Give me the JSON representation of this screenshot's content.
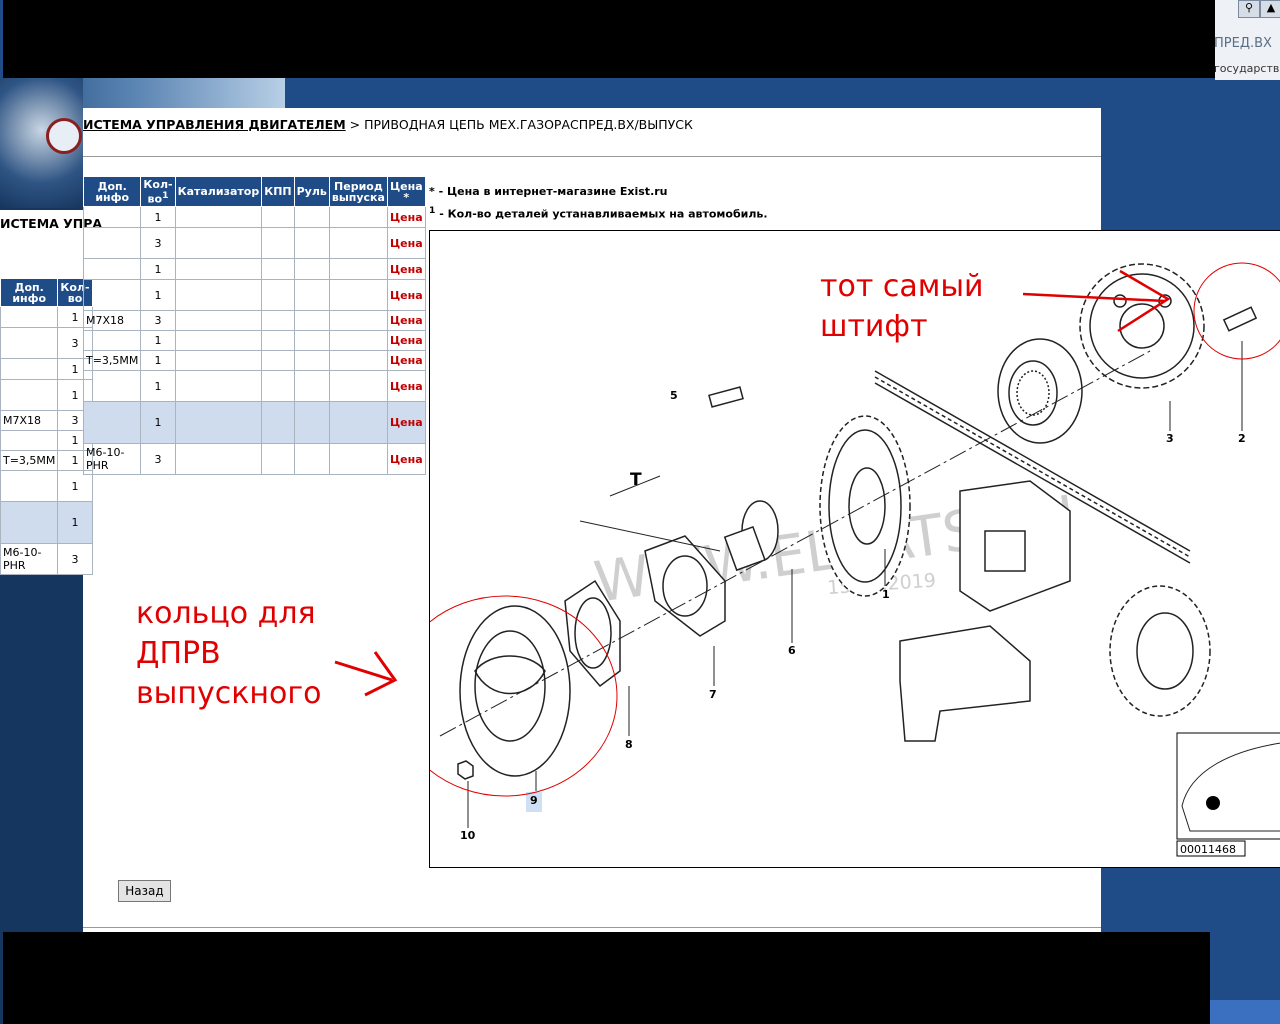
{
  "top_right": {
    "title_fragment": "ПРЕД.ВХ",
    "subtitle_fragment": "государствен"
  },
  "breadcrumb": {
    "link": "ИСТЕМА УПРАВЛЕНИЯ ДВИГАТЕЛЕМ",
    "sep": " > ",
    "current": "ПРИВОДНАЯ ЦЕПЬ МЕХ.ГАЗОРАСПРЕД.ВХ/ВЫПУСК"
  },
  "left_panel": {
    "title": "ИСТЕМА УПРА"
  },
  "table": {
    "headers": [
      "Доп. инфо",
      "Кол-во",
      "Катализатор",
      "КПП",
      "Руль",
      "Период выпуска",
      "Цена *"
    ],
    "qty_sup": "1",
    "rows": [
      {
        "info": "",
        "qty": "1",
        "price": "Цена"
      },
      {
        "info": "",
        "qty": "3",
        "price": "Цена"
      },
      {
        "info": "",
        "qty": "1",
        "price": "Цена"
      },
      {
        "info": "",
        "qty": "1",
        "price": "Цена"
      },
      {
        "info": "M7X18",
        "qty": "3",
        "price": "Цена"
      },
      {
        "info": "",
        "qty": "1",
        "price": "Цена"
      },
      {
        "info": "T=3,5MM",
        "qty": "1",
        "price": "Цена"
      },
      {
        "info": "",
        "qty": "1",
        "price": "Цена"
      },
      {
        "info": "",
        "qty": "1",
        "price": "Цена"
      },
      {
        "info": "M6-10-PHR",
        "qty": "3",
        "price": "Цена"
      }
    ]
  },
  "left_table": {
    "headers": [
      "Доп. инфо",
      "Кол-во"
    ],
    "rows": [
      {
        "info": "",
        "qty": "1"
      },
      {
        "info": "",
        "qty": "3"
      },
      {
        "info": "",
        "qty": "1"
      },
      {
        "info": "",
        "qty": "1"
      },
      {
        "info": "M7X18",
        "qty": "3"
      },
      {
        "info": "",
        "qty": "1"
      },
      {
        "info": "T=3,5MM",
        "qty": "1"
      },
      {
        "info": "",
        "qty": "1"
      },
      {
        "info": "",
        "qty": "1"
      },
      {
        "info": "M6-10-PHR",
        "qty": "3"
      }
    ]
  },
  "notes": {
    "note1": "* - Цена в интернет-магазине Exist.ru",
    "note2_sup": "1",
    "note2": " - Кол-во деталей устанавливаемых на автомобиль."
  },
  "diagram": {
    "watermark": "WWW.ELCATS.RU",
    "date": "15.12.2019",
    "t_label": "T",
    "part_numbers": [
      "1",
      "2",
      "3",
      "5",
      "6",
      "7",
      "8",
      "9",
      "10"
    ],
    "code": "00011468",
    "annotation_pin_line1": "тот самый",
    "annotation_pin_line2": "штифт",
    "annotation_ring_line1": "кольцо для",
    "annotation_ring_line2": "ДПРВ",
    "annotation_ring_line3": "выпускного",
    "annotation_color": "#e00000"
  },
  "back_button": "Назад",
  "colors": {
    "header_bg": "#1f4c86",
    "price_red": "#c00000",
    "highlight_row": "#cfdcee"
  }
}
